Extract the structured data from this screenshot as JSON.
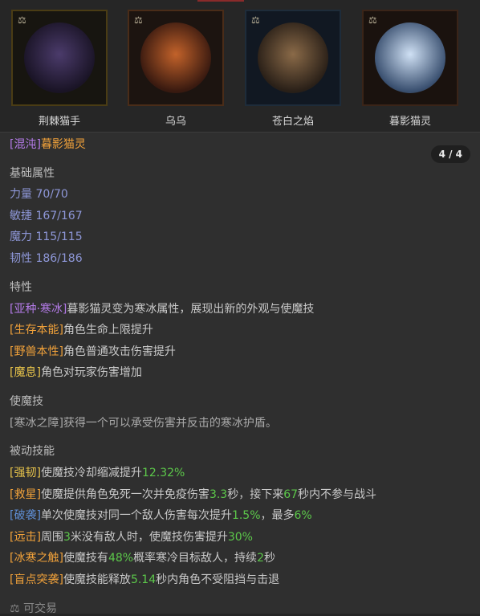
{
  "portraits": [
    {
      "name": "荆棘猫手",
      "frame_color": "#4a3c14",
      "bg": "#171510",
      "art_colors": [
        "#4b3b6b",
        "#1a1426"
      ]
    },
    {
      "name": "乌乌",
      "frame_color": "#4a2c18",
      "bg": "#1c1410",
      "art_colors": [
        "#c2622a",
        "#3a1a10"
      ]
    },
    {
      "name": "苍白之焰",
      "frame_color": "#1e2c3a",
      "bg": "#111822",
      "art_colors": [
        "#8a6a48",
        "#2a2018"
      ]
    },
    {
      "name": "暮影猫灵",
      "frame_color": "#3a2418",
      "bg": "#1a120e",
      "art_colors": [
        "#cfe0f4",
        "#3a5070"
      ]
    }
  ],
  "lock_icon": "⚖",
  "panel": {
    "title_tag": "[混沌]",
    "title_name": "暮影猫灵",
    "page": "4 / 4",
    "base_heading": "基础属性",
    "stats": [
      "力量 70/70",
      "敏捷 167/167",
      "魔力 115/115",
      "韧性 186/186"
    ],
    "traits_heading": "特性",
    "traits": [
      {
        "tag": "[亚种·寒冰]",
        "text": "暮影猫灵变为寒冰属性，展现出新的外观与使魔技",
        "tag_color": "purple"
      },
      {
        "tag": "[生存本能]",
        "text": "角色生命上限提升",
        "tag_color": "orange"
      },
      {
        "tag": "[野兽本性]",
        "text": "角色普通攻击伤害提升",
        "tag_color": "orange"
      },
      {
        "tag": "[魔息]",
        "text": "角色对玩家伤害增加",
        "tag_color": "yellow"
      }
    ],
    "skill_heading": "使魔技",
    "skill_text": "[寒冰之障]获得一个可以承受伤害并反击的寒冰护盾。",
    "passive_heading": "被动技能",
    "passives": [
      {
        "tag": "[强韧]",
        "tag_color": "yellow",
        "parts": [
          [
            "plain",
            "使魔技冷却缩减提升"
          ],
          [
            "green",
            "12.32%"
          ]
        ]
      },
      {
        "tag": "[救星]",
        "tag_color": "orange",
        "parts": [
          [
            "plain",
            "使魔提供角色免死一次并免疫伤害"
          ],
          [
            "green",
            "3.3"
          ],
          [
            "plain",
            "秒，接下来"
          ],
          [
            "green",
            "67"
          ],
          [
            "plain",
            "秒内不参与战斗"
          ]
        ]
      },
      {
        "tag": "[破袭]",
        "tag_color": "blue",
        "parts": [
          [
            "plain",
            "单次使魔技对同一个敌人伤害每次提升"
          ],
          [
            "green",
            "1.5%"
          ],
          [
            "plain",
            "，最多"
          ],
          [
            "green",
            "6%"
          ]
        ]
      },
      {
        "tag": "[远击]",
        "tag_color": "orange",
        "parts": [
          [
            "plain",
            "周围"
          ],
          [
            "green",
            "3"
          ],
          [
            "plain",
            "米没有敌人时，使魔技伤害提升"
          ],
          [
            "green",
            "30%"
          ]
        ]
      },
      {
        "tag": "[冰寒之触]",
        "tag_color": "orange",
        "parts": [
          [
            "plain",
            "使魔技有"
          ],
          [
            "green",
            "48%"
          ],
          [
            "plain",
            "概率寒冷目标敌人，持续"
          ],
          [
            "green",
            "2"
          ],
          [
            "plain",
            "秒"
          ]
        ]
      },
      {
        "tag": "[盲点突袭]",
        "tag_color": "orange",
        "parts": [
          [
            "plain",
            "使魔技能释放"
          ],
          [
            "green",
            "5.14"
          ],
          [
            "plain",
            "秒内角色不受阻挡与击退"
          ]
        ]
      }
    ],
    "tradable": "可交易"
  }
}
